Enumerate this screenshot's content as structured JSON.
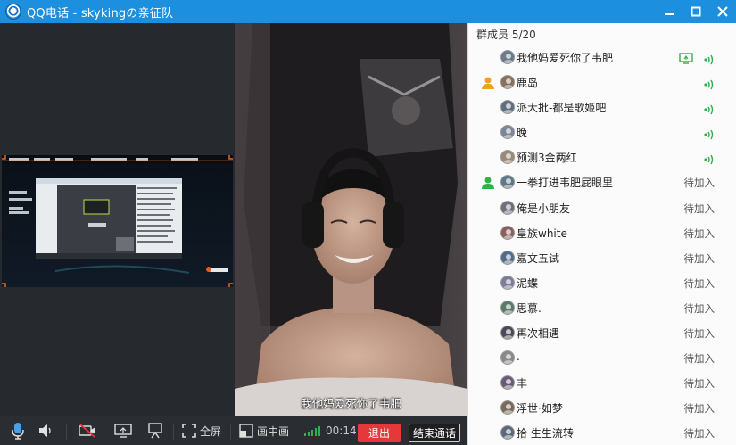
{
  "window": {
    "title": "QQ电话 - skykingの亲征队",
    "logo_icon": "qq-call-logo-icon",
    "buttons": [
      "minimize-icon",
      "maximize-icon",
      "close-icon"
    ]
  },
  "video": {
    "subtitle": "我他妈爱死你了韦肥"
  },
  "panel": {
    "header": "群成员 5/20",
    "accent_color": "#2fb24a",
    "members": [
      {
        "name": "我他妈爱死你了韦肥",
        "status": "",
        "mic": true,
        "sharing": true,
        "badge": ""
      },
      {
        "name": "鹿岛",
        "status": "",
        "mic": true,
        "sharing": false,
        "badge": "owner"
      },
      {
        "name": "派大批-都是歌姬吧",
        "status": "",
        "mic": true,
        "sharing": false,
        "badge": ""
      },
      {
        "name": "晚",
        "status": "",
        "mic": true,
        "sharing": false,
        "badge": ""
      },
      {
        "name": "预测3金两红",
        "status": "",
        "mic": true,
        "sharing": false,
        "badge": ""
      },
      {
        "name": "一拳打进韦肥屁眼里",
        "status": "待加入",
        "mic": false,
        "sharing": false,
        "badge": "admin"
      },
      {
        "name": "俺是小朋友",
        "status": "待加入",
        "mic": false,
        "sharing": false,
        "badge": ""
      },
      {
        "name": "皇族white",
        "status": "待加入",
        "mic": false,
        "sharing": false,
        "badge": ""
      },
      {
        "name": "嘉文五试",
        "status": "待加入",
        "mic": false,
        "sharing": false,
        "badge": ""
      },
      {
        "name": "泥蝶",
        "status": "待加入",
        "mic": false,
        "sharing": false,
        "badge": ""
      },
      {
        "name": "思慕.",
        "status": "待加入",
        "mic": false,
        "sharing": false,
        "badge": ""
      },
      {
        "name": "再次相遇",
        "status": "待加入",
        "mic": false,
        "sharing": false,
        "badge": ""
      },
      {
        "name": ".",
        "status": "待加入",
        "mic": false,
        "sharing": false,
        "badge": ""
      },
      {
        "name": "丰",
        "status": "待加入",
        "mic": false,
        "sharing": false,
        "badge": ""
      },
      {
        "name": "浮世·如梦",
        "status": "待加入",
        "mic": false,
        "sharing": false,
        "badge": ""
      },
      {
        "name": "拾 生生流转",
        "status": "待加入",
        "mic": false,
        "sharing": false,
        "badge": ""
      }
    ]
  },
  "toolbar": {
    "fullscreen_label": "全屏",
    "pip_label": "画中画",
    "timer": "00:14",
    "quit_label": "退出",
    "end_label": "结束通话"
  }
}
